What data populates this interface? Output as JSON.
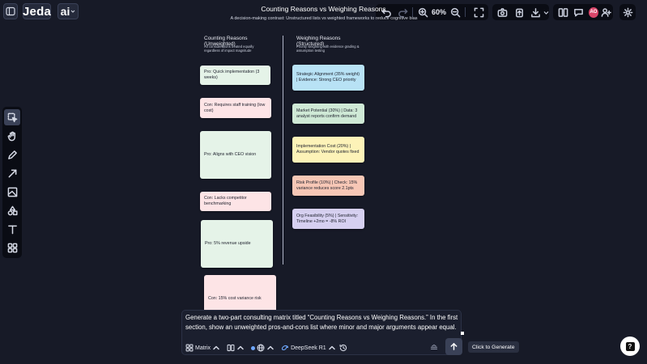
{
  "app": {
    "logo": "Jeda",
    "ai_label": "ai"
  },
  "board": {
    "title": "Counting Reasons vs Weighing Reasons",
    "subtitle": "A decision-making contrast: Unstructured lists vs weighted frameworks to reduce cognitive bias",
    "left_column": {
      "heading": "Counting Reasons (Unweighted)",
      "subheading": "All considerations treated equally regardless of impact magnitude"
    },
    "right_column": {
      "heading": "Weighing Reasons (Structured)",
      "subheading": "Priority weighting with evidence grading & assumption testing"
    },
    "left_cards": [
      {
        "text": "Pro: Quick implementation (3 weeks)"
      },
      {
        "text": "Con: Requires staff training (low cost)"
      },
      {
        "text": "Pro: Aligns with CEO vision"
      },
      {
        "text": "Con: Lacks competitor benchmarking"
      },
      {
        "text": "Pro: 5% revenue upside"
      },
      {
        "text": "Con: 15% cost variance risk"
      }
    ],
    "right_cards": [
      {
        "text": "Strategic Alignment (35% weight) | Evidence: Strong CEO priority"
      },
      {
        "text": "Market Potential (30%) | Data: 3 analyst reports confirm demand"
      },
      {
        "text": "Implementation Cost (20%) | Assumption: Vendor quotes fixed"
      },
      {
        "text": "Risk Profile (10%) | Check: 15% variance reduces score 2.1pts"
      },
      {
        "text": "Org Feasibility (5%) | Sensitivity: Timeline +2mo = -8% ROI"
      }
    ]
  },
  "toolbar": {
    "zoom": "60%",
    "avatar_initials": "AO"
  },
  "prompt": {
    "text": "Generate a two-part consulting matrix titled “Counting Reasons vs Weighing Reasons.” In the first section, show an unweighted pros-and-cons list where minor and major arguments appear equal.",
    "template_label": "Matrix",
    "model_label": "DeepSeek R1",
    "tooltip": "Click to Generate"
  },
  "colors": {
    "background": "#171a27",
    "accent_avatar": "#d9466a"
  },
  "icons": {
    "sidebar": "panel-icon",
    "undo": "undo-icon",
    "redo": "redo-icon",
    "zoom_in": "zoom-in-icon",
    "zoom_out": "zoom-out-icon",
    "fit": "fit-screen-icon",
    "camera": "camera-icon",
    "upload": "upload-icon",
    "download": "download-icon",
    "settings": "gear-icon",
    "help": "help-icon"
  }
}
